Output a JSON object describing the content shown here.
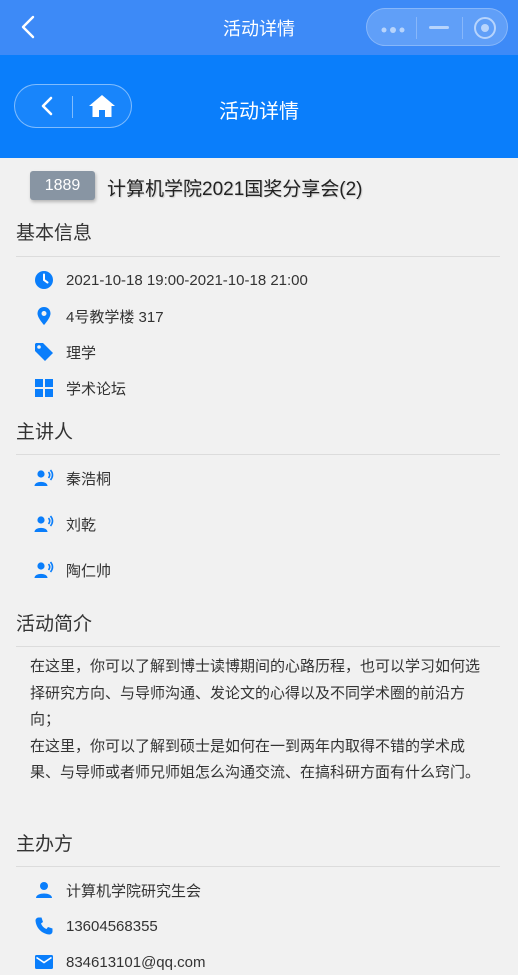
{
  "topbar": {
    "title": "活动详情"
  },
  "header": {
    "title": "活动详情"
  },
  "event": {
    "id": "1889",
    "title": "计算机学院2021国奖分享会(2)"
  },
  "sections": {
    "basic": "基本信息",
    "speakers": "主讲人",
    "intro": "活动简介",
    "organizer": "主办方"
  },
  "basic": {
    "time": "2021-10-18 19:00-2021-10-18 21:00",
    "location": "4号教学楼 317",
    "tag": "理学",
    "category": "学术论坛"
  },
  "speakers": [
    "秦浩桐",
    "刘乾",
    "陶仁帅"
  ],
  "intro": {
    "p1": "在这里，你可以了解到博士读博期间的心路历程，也可以学习如何选择研究方向、与导师沟通、发论文的心得以及不同学术圈的前沿方向；",
    "p2": "在这里，你可以了解到硕士是如何在一到两年内取得不错的学术成果、与导师或者师兄师姐怎么沟通交流、在搞科研方面有什么窍门。"
  },
  "organizer": {
    "name": "计算机学院研究生会",
    "phone": "13604568355",
    "email": "834613101@qq.com"
  },
  "colors": {
    "accent": "#0a7efb",
    "topbar": "#3d8af7",
    "icon": "#0a7efb",
    "id_badge": "#8895a3"
  },
  "icons": [
    "back-icon",
    "more-icon",
    "minimize-icon",
    "record-icon",
    "home-icon",
    "clock-icon",
    "location-pin-icon",
    "tag-icon",
    "grid-icon",
    "speaker-icon",
    "person-icon",
    "phone-icon",
    "mail-icon"
  ]
}
